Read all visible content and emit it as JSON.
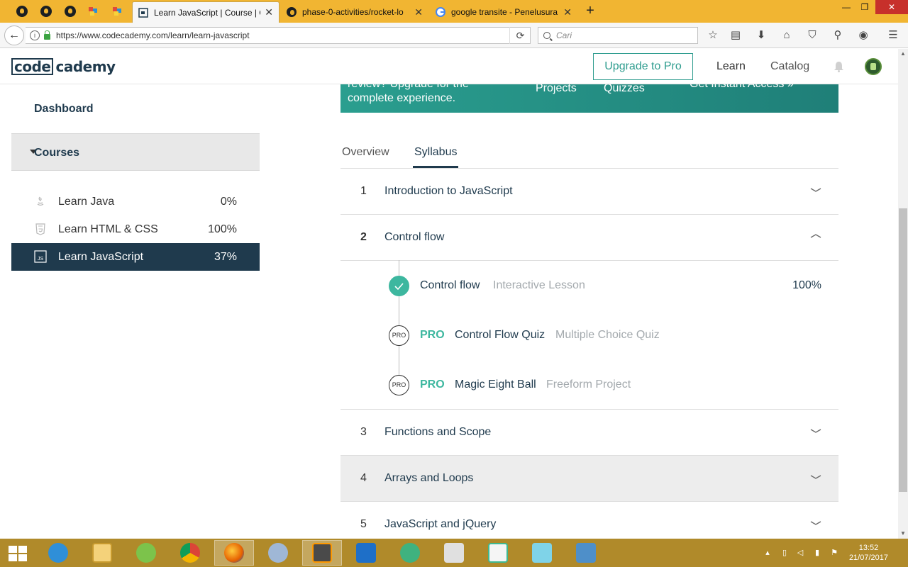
{
  "browser": {
    "tabs": [
      {
        "title": "Learn JavaScript | Course | C",
        "active": true
      },
      {
        "title": "phase-0-activities/rocket-lo",
        "active": false
      },
      {
        "title": "google transite - Penelusura",
        "active": false
      }
    ],
    "url": "https://www.codecademy.com/learn/learn-javascript",
    "search_placeholder": "Cari"
  },
  "header": {
    "logo_box": "code",
    "logo_rest": "cademy",
    "upgrade_label": "Upgrade to Pro",
    "nav_learn": "Learn",
    "nav_catalog": "Catalog"
  },
  "sidebar": {
    "dashboard": "Dashboard",
    "courses_label": "Courses",
    "courses": [
      {
        "label": "Learn Java",
        "progress": "0%",
        "icon": "java-icon"
      },
      {
        "label": "Learn HTML & CSS",
        "progress": "100%",
        "icon": "html5-icon"
      },
      {
        "label": "Learn JavaScript",
        "progress": "37%",
        "icon": "js-icon",
        "active": true
      }
    ]
  },
  "banner": {
    "line1": "review? Upgrade for the",
    "line2": "complete experience.",
    "projects": "Projects",
    "quizzes": "Quizzes",
    "access": "Get Instant Access »"
  },
  "tabs": {
    "overview": "Overview",
    "syllabus": "Syllabus"
  },
  "syllabus": {
    "units": [
      {
        "number": "1",
        "title": "Introduction to JavaScript",
        "expanded": false
      },
      {
        "number": "2",
        "title": "Control flow",
        "expanded": true
      },
      {
        "number": "3",
        "title": "Functions and Scope",
        "expanded": false
      },
      {
        "number": "4",
        "title": "Arrays and Loops",
        "expanded": false
      },
      {
        "number": "5",
        "title": "JavaScript and jQuery",
        "expanded": false
      }
    ],
    "lessons": [
      {
        "badge": "",
        "pro": "",
        "name": "Control flow",
        "type": "Interactive Lesson",
        "progress": "100%",
        "completed": true
      },
      {
        "badge": "PRO",
        "pro": "PRO",
        "name": "Control Flow Quiz",
        "type": "Multiple Choice Quiz",
        "progress": ""
      },
      {
        "badge": "PRO",
        "pro": "PRO",
        "name": "Magic Eight Ball",
        "type": "Freeform Project",
        "progress": ""
      }
    ]
  },
  "taskbar": {
    "time": "13:52",
    "date": "21/07/2017"
  },
  "colors": {
    "brand_navy": "#1f3a4d",
    "teal": "#3db79f",
    "chrome_yellow": "#f1b532",
    "taskbar": "#b08a2a"
  }
}
